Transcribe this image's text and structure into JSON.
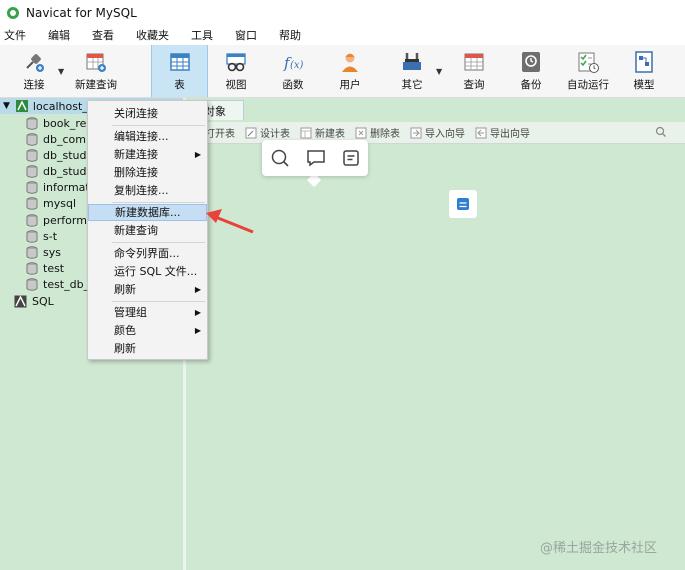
{
  "window": {
    "title": "Navicat for MySQL"
  },
  "menubar": {
    "items": [
      "文件",
      "编辑",
      "查看",
      "收藏夹",
      "工具",
      "窗口",
      "帮助"
    ]
  },
  "toolbar": {
    "connect": "连接",
    "new_query": "新建查询",
    "table": "表",
    "view": "视图",
    "function": "函数",
    "user": "用户",
    "other": "其它",
    "query": "查询",
    "backup": "备份",
    "autorun": "自动运行",
    "model": "模型"
  },
  "sidebar": {
    "connection": "localhost_3",
    "databases": [
      "book_rea",
      "db_comp",
      "db_stude",
      "db_stude",
      "informati",
      "mysql",
      "performa",
      "s-t",
      "sys",
      "test",
      "test_db_c"
    ],
    "sql_label": "SQL"
  },
  "tabs": {
    "objects": "对象"
  },
  "object_toolbar": {
    "open": "打开表",
    "design": "设计表",
    "new": "新建表",
    "delete": "删除表",
    "import": "导入向导",
    "export": "导出向导"
  },
  "context_menu": {
    "close": "关闭连接",
    "edit": "编辑连接...",
    "new_conn": "新建连接",
    "delete_conn": "删除连接",
    "copy_conn": "复制连接...",
    "new_db": "新建数据库...",
    "new_query": "新建查询",
    "cmdline": "命令列界面...",
    "run_sql": "运行 SQL 文件...",
    "refresh1": "刷新",
    "manage_group": "管理组",
    "color": "颜色",
    "refresh2": "刷新"
  },
  "watermark": "@稀土掘金技术社区",
  "colors": {
    "accent": "#c9e4f5",
    "background": "#cfe8d2",
    "arrow": "#e8433a"
  }
}
